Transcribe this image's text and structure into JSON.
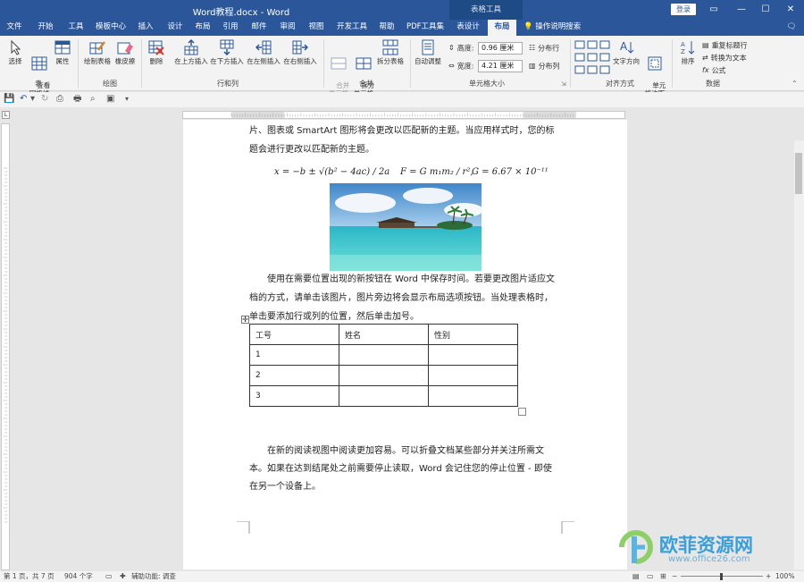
{
  "title_bar": {
    "document_title": "Word教程.docx - Word",
    "context_group": "表格工具",
    "login_label": "登录"
  },
  "tabs": [
    {
      "label": "文件"
    },
    {
      "label": "开始"
    },
    {
      "label": "工具"
    },
    {
      "label": "模板中心"
    },
    {
      "label": "插入"
    },
    {
      "label": "设计"
    },
    {
      "label": "布局"
    },
    {
      "label": "引用"
    },
    {
      "label": "邮件"
    },
    {
      "label": "审阅"
    },
    {
      "label": "视图"
    },
    {
      "label": "开发工具"
    },
    {
      "label": "帮助"
    },
    {
      "label": "PDF工具集"
    },
    {
      "label": "表设计"
    },
    {
      "label": "布局",
      "active": true
    },
    {
      "label": "操作说明搜索"
    }
  ],
  "ribbon": {
    "table": {
      "select": "选择",
      "view_grid": "查看\n网格线",
      "properties": "属性",
      "group": "表"
    },
    "draw": {
      "draw_table": "绘制表格",
      "eraser": "橡皮擦",
      "group": "绘图"
    },
    "rows_cols": {
      "delete": "删除",
      "insert_above": "在上方插入",
      "insert_below": "在下方插入",
      "insert_left": "在左侧插入",
      "insert_right": "在右侧插入",
      "group": "行和列"
    },
    "merge": {
      "merge_cells": "合并\n单元格",
      "split_cells": "拆分\n单元格",
      "split_table": "拆分表格",
      "group": "合并"
    },
    "cell_size": {
      "autofit": "自动调整",
      "height_label": "高度:",
      "height_value": "0.96 厘米",
      "width_label": "宽度:",
      "width_value": "4.21 厘米",
      "distribute_rows": "分布行",
      "distribute_cols": "分布列",
      "group": "单元格大小"
    },
    "alignment": {
      "text_direction": "文字方向",
      "cell_margins": "单元\n格边距",
      "group": "对齐方式"
    },
    "data": {
      "sort": "排序",
      "repeat_header": "重复标题行",
      "convert_text": "转换为文本",
      "formula": "公式",
      "group": "数据"
    }
  },
  "document": {
    "para1_line1": "片、图表或 SmartArt 图形将会更改以匹配新的主题。当应用样式时，您的标",
    "para1_line2": "题会进行更改以匹配新的主题。",
    "formula_1": "x = −b ± √(b² − 4ac) / 2a",
    "formula_2": "F = G m₁m₂ / r²,",
    "formula_3": "G = 6.67 × 10⁻¹¹",
    "para2_line1": "使用在需要位置出现的新按钮在 Word 中保存时间。若要更改图片适应文",
    "para2_line2": "档的方式，请单击该图片，图片旁边将会显示布局选项按钮。当处理表格时，",
    "para2_line3": "单击要添加行或列的位置，然后单击加号。",
    "table_header": [
      "工号",
      "姓名",
      "性别"
    ],
    "table_rows": [
      [
        "1",
        "",
        ""
      ],
      [
        "2",
        "",
        ""
      ],
      [
        "3",
        "",
        ""
      ]
    ],
    "para3_line1": "在新的阅读视图中阅读更加容易。可以折叠文档某些部分并关注所需文",
    "para3_line2": "本。如果在达到结尾处之前需要停止读取，Word 会记住您的停止位置 - 即使",
    "para3_line3": "在另一个设备上。"
  },
  "status": {
    "page": "第 1 页，共 7 页",
    "words": "904 个字",
    "accessibility": "辅助功能: 调查",
    "zoom": "100%"
  },
  "watermark": {
    "brand": "欧菲资源网",
    "site": "www.office26.com"
  },
  "colors": {
    "accent": "#2b579a"
  }
}
